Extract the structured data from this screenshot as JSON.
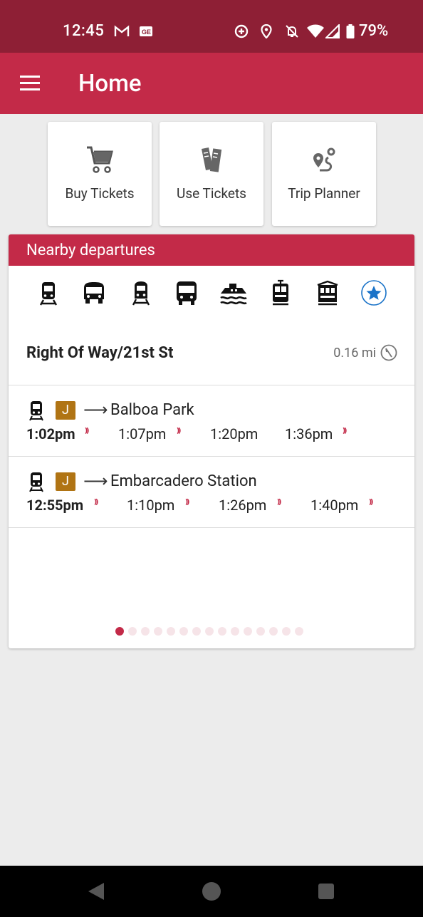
{
  "status_bar": {
    "time": "12:45",
    "battery": "79%",
    "icons": [
      "gmail-icon",
      "news-icon",
      "data-saver-icon",
      "location-icon",
      "notifications-off-icon",
      "wifi-icon",
      "cellular-icon",
      "battery-icon"
    ]
  },
  "app_bar": {
    "title": "Home",
    "menu_icon": "hamburger-menu-icon"
  },
  "quick_actions": [
    {
      "label": "Buy Tickets",
      "icon": "cart-icon"
    },
    {
      "label": "Use Tickets",
      "icon": "tickets-icon"
    },
    {
      "label": "Trip Planner",
      "icon": "route-icon"
    }
  ],
  "nearby": {
    "header": "Nearby departures",
    "modes": [
      "light-rail-icon",
      "bus-front-icon",
      "train-icon",
      "bus-icon",
      "ferry-icon",
      "streetcar-icon",
      "cable-car-icon",
      "favorites-star-icon"
    ],
    "stop": {
      "name": "Right Of Way/21st St",
      "distance": "0.16 mi"
    },
    "departures": [
      {
        "line": "J",
        "arrow": "⟶",
        "destination": "Balboa Park",
        "times": [
          "1:02pm",
          "1:07pm",
          "1:20pm",
          "1:36pm"
        ]
      },
      {
        "line": "J",
        "arrow": "⟶",
        "destination": "Embarcadero Station",
        "times": [
          "12:55pm",
          "1:10pm",
          "1:26pm",
          "1:40pm"
        ]
      }
    ],
    "page_count": 15,
    "active_page": 1
  },
  "realtime_mark": "⁾⁾",
  "colors": {
    "status_bar": "#8e1f35",
    "primary": "#c32a48",
    "line_j": "#b07414",
    "star": "#1a73c8"
  }
}
